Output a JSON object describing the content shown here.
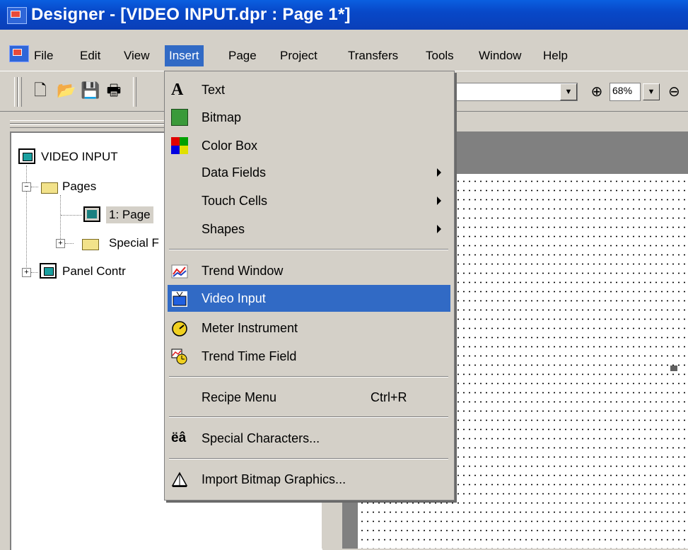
{
  "window": {
    "title": "Designer - [VIDEO INPUT.dpr : Page 1*]"
  },
  "menubar": {
    "items": [
      "File",
      "Edit",
      "View",
      "Insert",
      "Page",
      "Project",
      "Transfers",
      "Tools",
      "Window",
      "Help"
    ],
    "active": "Insert"
  },
  "toolbar": {
    "icons": [
      "new-file-icon",
      "open-folder-icon",
      "save-icon",
      "print-icon"
    ],
    "zoom_value": "68%"
  },
  "tree": {
    "root": "VIDEO INPUT",
    "pages_folder": "Pages",
    "page_item": "1: Page",
    "special_folder": "Special F",
    "panel_control": "Panel  Contr"
  },
  "insert_menu": {
    "items": [
      {
        "label": "Text",
        "icon": "text-icon",
        "submenu": false
      },
      {
        "label": "Bitmap",
        "icon": "bitmap-icon",
        "submenu": false
      },
      {
        "label": "Color Box",
        "icon": "color-box-icon",
        "submenu": false
      },
      {
        "label": "Data Fields",
        "icon": "",
        "submenu": true
      },
      {
        "label": "Touch Cells",
        "icon": "",
        "submenu": true
      },
      {
        "label": "Shapes",
        "icon": "",
        "submenu": true
      },
      {
        "label": "Trend Window",
        "icon": "trend-window-icon",
        "submenu": false
      },
      {
        "label": "Video Input",
        "icon": "video-input-icon",
        "submenu": false,
        "highlighted": true
      },
      {
        "label": "Meter Instrument",
        "icon": "meter-icon",
        "submenu": false
      },
      {
        "label": "Trend Time Field",
        "icon": "trend-time-icon",
        "submenu": false
      },
      {
        "label": "Recipe Menu",
        "icon": "",
        "shortcut": "Ctrl+R",
        "submenu": false
      },
      {
        "label": "Special Characters...",
        "icon": "special-characters-icon",
        "icon_text": "ëâ",
        "submenu": false
      },
      {
        "label": "Import Bitmap Graphics...",
        "icon": "import-bitmap-icon",
        "submenu": false
      }
    ]
  },
  "colors": {
    "highlight": "#316ac5",
    "titlebar": "#0848c8",
    "face": "#d4d0c8"
  }
}
